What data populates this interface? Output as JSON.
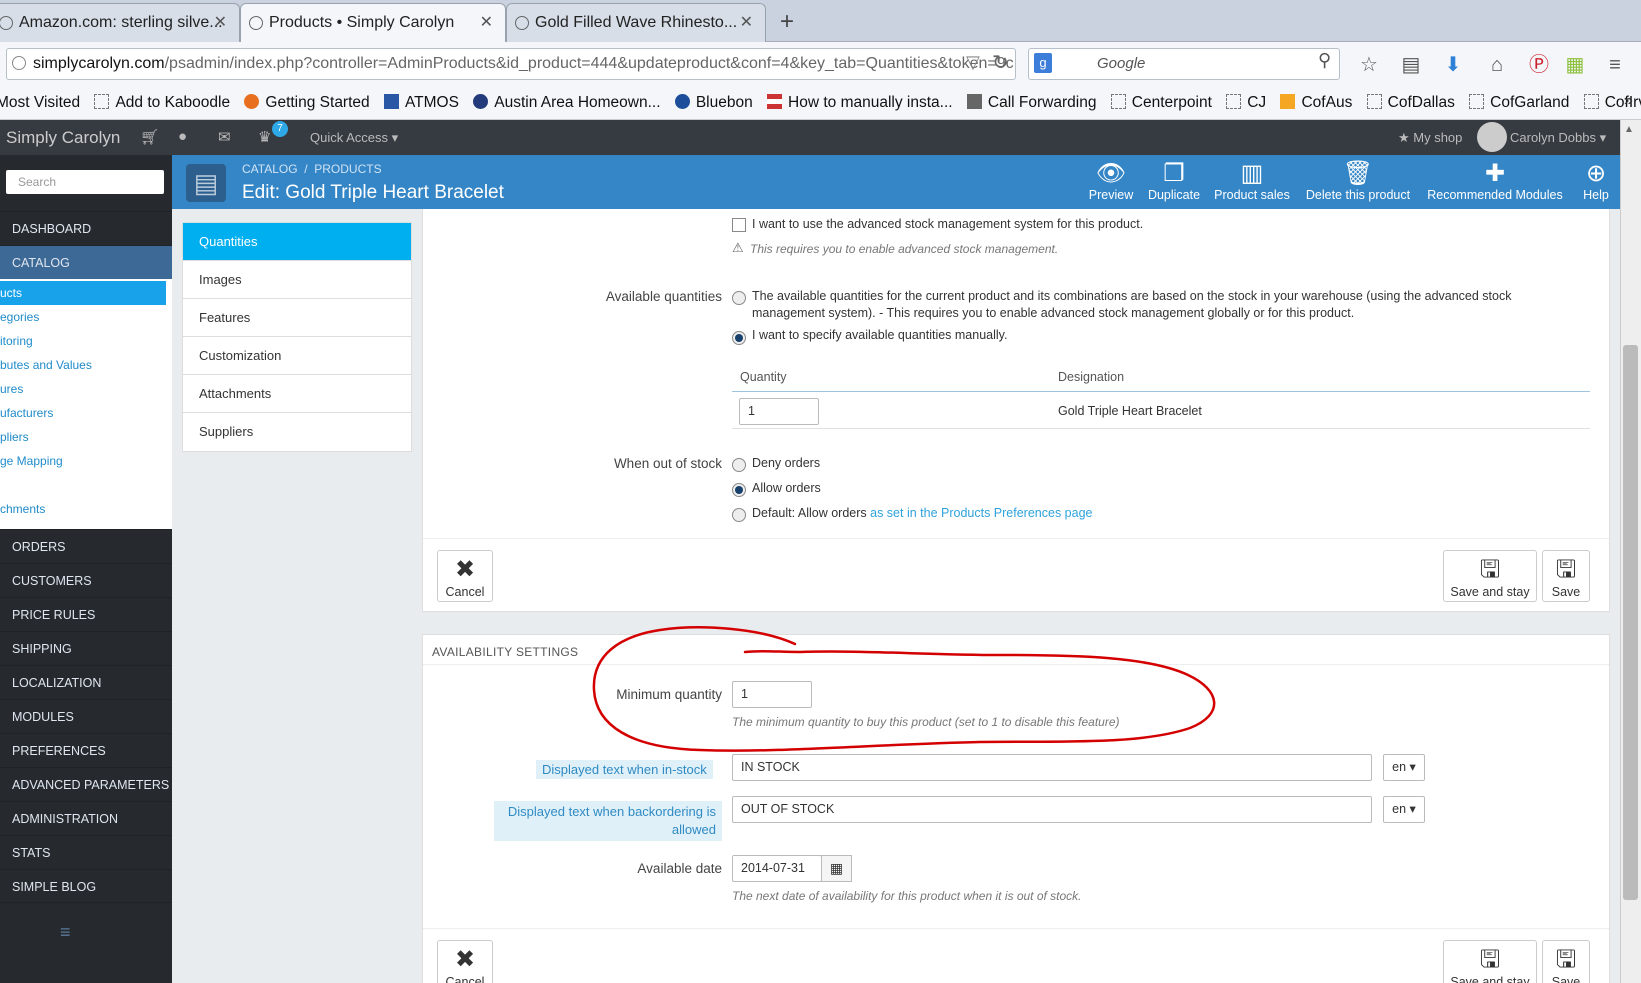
{
  "browser": {
    "tabs": [
      {
        "title": "Amazon.com: sterling silve...",
        "close": "✕"
      },
      {
        "title": "Products • Simply Carolyn",
        "close": "✕"
      },
      {
        "title": "Gold Filled Wave Rhinesto...",
        "close": "✕"
      }
    ],
    "new_tab": "+",
    "url_domain": "simplycarolyn.com",
    "url_path": "/psadmin/index.php?controller=AdminProducts&id_product=444&updateproduct&conf=4&key_tab=Quantities&token=9c",
    "search_placeholder": "Google",
    "bookmarks": [
      "Most Visited",
      "Add to Kaboodle",
      "Getting Started",
      "ATMOS",
      "Austin Area Homeown...",
      "Bluebon",
      "How to manually insta...",
      "Call Forwarding",
      "Centerpoint",
      "CJ",
      "CofAus",
      "CofDallas",
      "CofGarland",
      "CofIrving"
    ],
    "more": "»"
  },
  "admin": {
    "brand": "Simply Carolyn",
    "badge": "7",
    "quick_access": "Quick Access ▾",
    "my_shop": "★ My shop",
    "user": "Carolyn Dobbs ▾"
  },
  "toolbar": {
    "breadcrumb_1": "CATALOG",
    "breadcrumb_sep": "/",
    "breadcrumb_2": "PRODUCTS",
    "title": "Edit: Gold Triple Heart Bracelet",
    "preview": "Preview",
    "duplicate": "Duplicate",
    "sales": "Product sales",
    "delete": "Delete this product",
    "modules": "Recommended Modules",
    "help": "Help"
  },
  "sidebar": {
    "search": "Search",
    "dashboard": "DASHBOARD",
    "catalog": "CATALOG",
    "catalog_sub": [
      "ucts",
      "egories",
      "itoring",
      "butes and Values",
      "ures",
      "ufacturers",
      "pliers",
      "ge Mapping",
      "",
      "chments"
    ],
    "menu": [
      "ORDERS",
      "CUSTOMERS",
      "PRICE RULES",
      "SHIPPING",
      "LOCALIZATION",
      "MODULES",
      "PREFERENCES",
      "ADVANCED PARAMETERS",
      "ADMINISTRATION",
      "STATS",
      "SIMPLE BLOG"
    ],
    "collapse": "≡"
  },
  "product_tabs": [
    "Quantities",
    "Images",
    "Features",
    "Customization",
    "Attachments",
    "Suppliers"
  ],
  "quantities": {
    "adv_stock": "I want to use the advanced stock management system for this product.",
    "adv_stock_help": "This requires you to enable advanced stock management.",
    "avail_label": "Available quantities",
    "avail_opt1": "The available quantities for the current product and its combinations are based on the stock in your warehouse (using the advanced stock management system).  - This requires you to enable advanced stock management globally or for this product.",
    "avail_opt2": "I want to specify available quantities manually.",
    "col_qty": "Quantity",
    "col_desig": "Designation",
    "row_qty": "1",
    "row_desig": "Gold Triple Heart Bracelet",
    "oos_label": "When out of stock",
    "oos_deny": "Deny orders",
    "oos_allow": "Allow orders",
    "oos_default": "Default: Allow orders",
    "oos_link": "as set in the Products Preferences page",
    "cancel": "Cancel",
    "save_stay": "Save and stay",
    "save": "Save"
  },
  "availability": {
    "heading": "AVAILABILITY SETTINGS",
    "min_qty_label": "Minimum quantity",
    "min_qty": "1",
    "min_qty_help": "The minimum quantity to buy this product (set to 1 to disable this feature)",
    "instock_label": "Displayed text when in-stock",
    "instock": "IN STOCK",
    "lang": "en ▾",
    "backorder_label_1": "Displayed text when backordering is",
    "backorder_label_2": "allowed",
    "backorder": "OUT OF STOCK",
    "date_label": "Available date",
    "date": "2014-07-31",
    "date_help": "The next date of availability for this product when it is out of stock.",
    "cancel": "Cancel",
    "save_stay": "Save and stay",
    "save": "Save"
  },
  "colors": {
    "accent": "#00aff0",
    "toolbar": "#3586c7",
    "sidebar": "#262a2f",
    "annotation": "#d40000"
  }
}
